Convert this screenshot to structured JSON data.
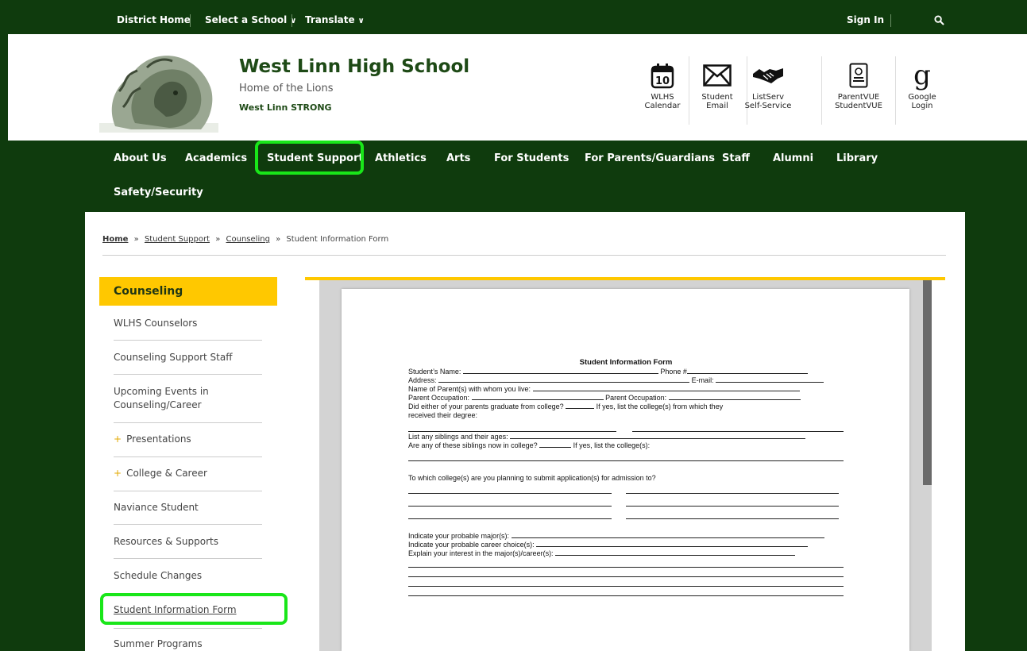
{
  "utility_bar": {
    "district_home": "District Home",
    "select_school": "Select a School",
    "translate": "Translate",
    "sign_in": "Sign In"
  },
  "header": {
    "school_name": "West Linn High School",
    "tagline": "Home of the Lions",
    "motto": "West Linn STRONG"
  },
  "quick_links": {
    "calendar_day": "10",
    "calendar_l1": "WLHS",
    "calendar_l2": "Calendar",
    "email_l1": "Student",
    "email_l2": "Email",
    "listserv_l1": "ListServ",
    "listserv_l2": "Self-Service",
    "parentvue_l1": "ParentVUE",
    "parentvue_l2": "StudentVUE",
    "google_glyph": "g",
    "google_l1": "Google",
    "google_l2": "Login"
  },
  "nav": {
    "about": "About Us",
    "academics": "Academics",
    "student_support": "Student Support",
    "athletics": "Athletics",
    "arts": "Arts",
    "for_students": "For Students",
    "for_parents": "For Parents/Guardians",
    "staff": "Staff",
    "alumni": "Alumni",
    "library": "Library",
    "safety": "Safety/Security"
  },
  "breadcrumb": {
    "home": "Home",
    "sep": "»",
    "student_support": "Student Support",
    "counseling": "Counseling",
    "current": "Student Information Form"
  },
  "sidebar": {
    "heading": "Counseling",
    "counselors": "WLHS Counselors",
    "support_staff": "Counseling Support Staff",
    "upcoming_l1": "Upcoming Events in",
    "upcoming_l2": "Counseling/Career",
    "plus": "+",
    "presentations": "Presentations",
    "college_career": "College & Career",
    "naviance": "Naviance Student",
    "resources": "Resources & Supports",
    "schedule": "Schedule Changes",
    "student_info_form": "Student Information Form",
    "summer": "Summer Programs"
  },
  "form": {
    "title": "Student Information Form",
    "student_name": "Student’s Name:",
    "phone": "Phone #",
    "address": "Address:",
    "email": "E-mail:",
    "parents_live": "Name of Parent(s) with whom you live:",
    "parent_occ": "Parent Occupation:",
    "grad_q": "Did either of your parents graduate from college?",
    "grad_if": "If yes, list the college(s) from which they",
    "grad_cont": "received their degree:",
    "siblings": "List any siblings and their ages:",
    "siblings_college": "Are any of these siblings now in college?",
    "siblings_if": "If yes, list the college(s):",
    "apply_q": "To which college(s) are you planning to submit application(s) for admission to?",
    "major": "Indicate your probable major(s):",
    "career": "Indicate your probable career choice(s):",
    "interest": "Explain your interest in the major(s)/career(s):"
  },
  "colors": {
    "brand_green": "#0f3b0d",
    "gold": "#ffc800",
    "highlight": "#19e619"
  },
  "icons": [
    "calendar-icon",
    "envelope-icon",
    "handshake-icon",
    "id-badge-icon",
    "google-icon",
    "search-icon",
    "chevron-down-icon"
  ]
}
